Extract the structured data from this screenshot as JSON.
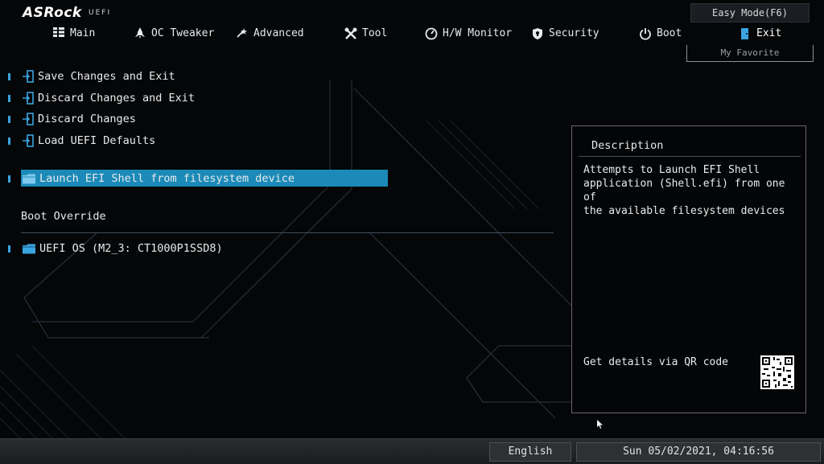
{
  "header": {
    "brand": "ASRock",
    "brand_sub": "UEFI",
    "easy_mode": "Easy Mode(F6)",
    "my_favorite": "My Favorite"
  },
  "nav": {
    "main": "Main",
    "oc_tweaker": "OC Tweaker",
    "advanced": "Advanced",
    "tool": "Tool",
    "hw_monitor": "H/W Monitor",
    "security": "Security",
    "boot": "Boot",
    "exit": "Exit",
    "active": "Exit"
  },
  "menu": {
    "save_exit": "Save Changes and Exit",
    "discard_exit": "Discard Changes and Exit",
    "discard": "Discard Changes",
    "load_defaults": "Load UEFI Defaults",
    "launch_shell": "Launch EFI Shell from filesystem device",
    "boot_override": "Boot Override",
    "uefi_os": "UEFI OS (M2_3: CT1000P1SSD8)"
  },
  "description": {
    "title": "Description",
    "text": "Attempts to Launch EFI Shell\napplication (Shell.efi) from one of\nthe available filesystem devices",
    "qr_label": "Get details via QR code"
  },
  "footer": {
    "language": "English",
    "datetime": "Sun 05/02/2021, 04:16:56"
  },
  "colors": {
    "accent": "#3aa4e0",
    "highlight": "#1c8ab8",
    "background": "#050607"
  }
}
